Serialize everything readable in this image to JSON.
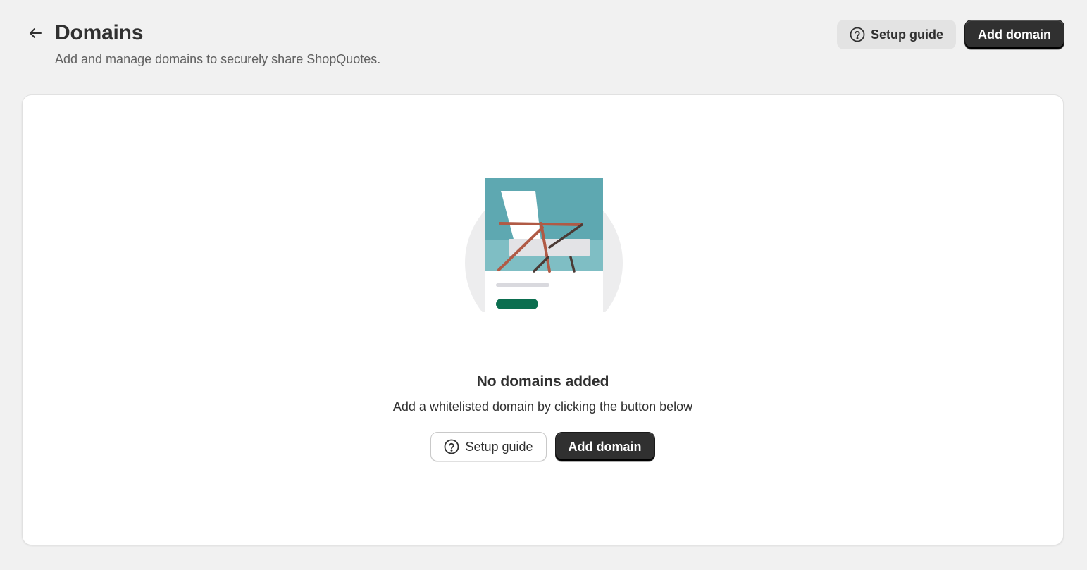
{
  "header": {
    "back_icon": "arrow-left-icon",
    "title": "Domains",
    "subtitle": "Add and manage domains to securely share ShopQuotes.",
    "setup_guide_label": "Setup guide",
    "add_domain_label": "Add domain"
  },
  "empty_state": {
    "illustration": "empty-state-chair-card-illustration",
    "heading": "No domains added",
    "text": "Add a whitelisted domain by clicking the button below",
    "setup_guide_label": "Setup guide",
    "add_domain_label": "Add domain"
  },
  "colors": {
    "background": "#f1f1f1",
    "card": "#ffffff",
    "primary_button": "#303030",
    "illustration_teal": "#5ea8b1",
    "illustration_green": "#0b6e4f"
  }
}
